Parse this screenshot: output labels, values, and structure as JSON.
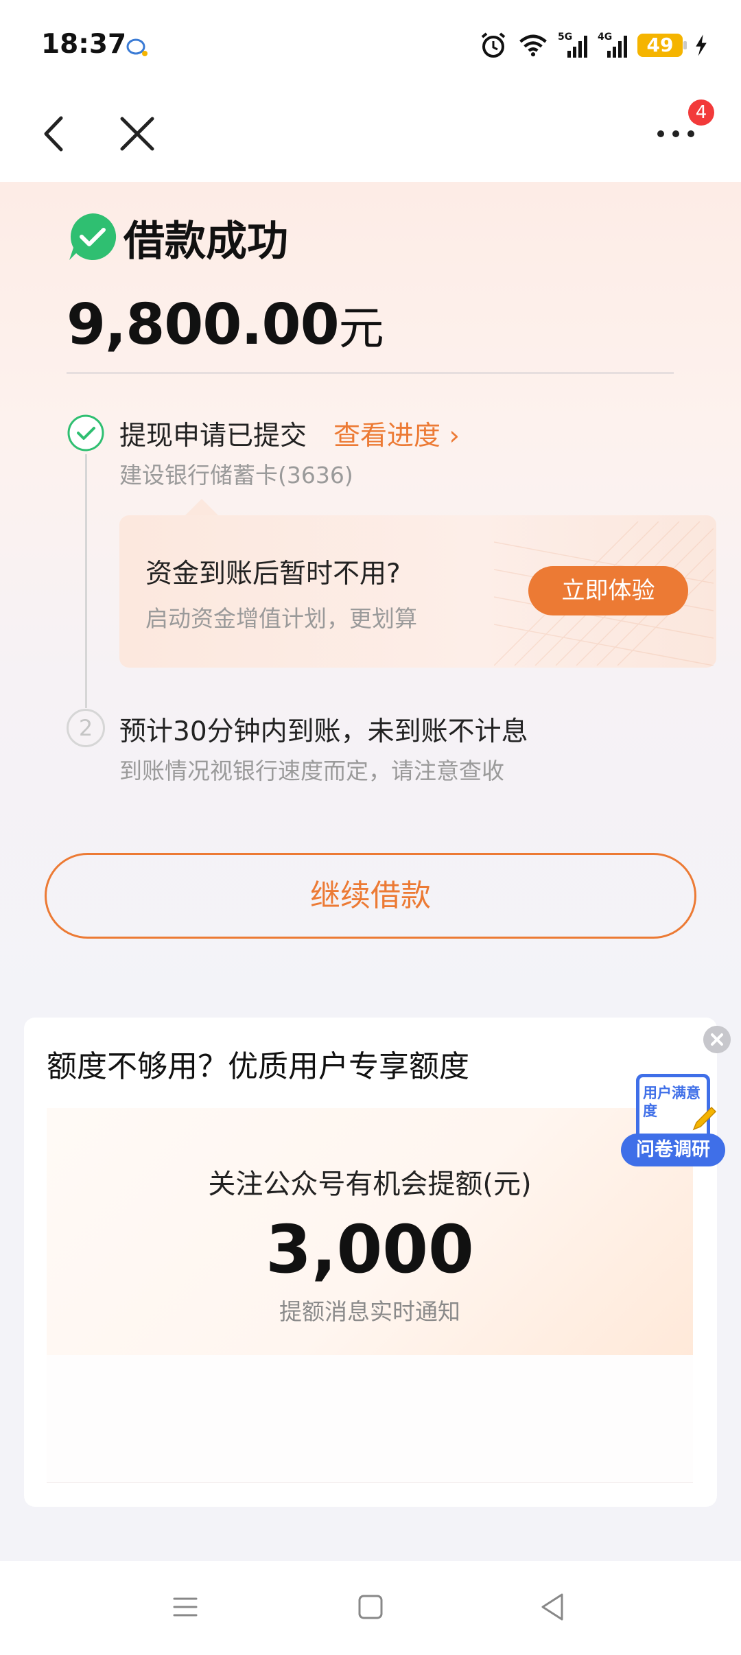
{
  "status_bar": {
    "time": "18:37",
    "battery": "49",
    "icons": [
      "notification-icon",
      "alarm-icon",
      "wifi-icon",
      "signal-5g-icon",
      "signal-4g-icon",
      "battery-icon",
      "charging-icon"
    ]
  },
  "nav": {
    "badge_count": "4",
    "icons": [
      "back-icon",
      "close-icon",
      "more-icon"
    ]
  },
  "result": {
    "title": "借款成功",
    "amount": "9,800.00",
    "amount_unit": "元"
  },
  "steps": {
    "step1_title": "提现申请已提交",
    "step1_link": "查看进度 ›",
    "step1_sub": "建设银行储蓄卡(3636)",
    "step2_number": "2",
    "step2_title": "预计30分钟内到账，未到账不计息",
    "step2_sub": "到账情况视银行速度而定，请注意查收"
  },
  "promo": {
    "title": "资金到账后暂时不用?",
    "subtitle": "启动资金增值计划，更划算",
    "button": "立即体验"
  },
  "continue_button": "继续借款",
  "quota_card": {
    "title": "额度不够用？优质用户专享额度",
    "inner_title": "关注公众号有机会提额(元)",
    "inner_amount": "3,000",
    "inner_sub": "提额消息实时通知"
  },
  "survey": {
    "doc_text": "用户满意度",
    "pill": "问卷调研"
  },
  "colors": {
    "accent": "#ec7a34",
    "success": "#2fbf71",
    "survey_blue": "#3f6fe8",
    "badge_red": "#f23a3a"
  }
}
